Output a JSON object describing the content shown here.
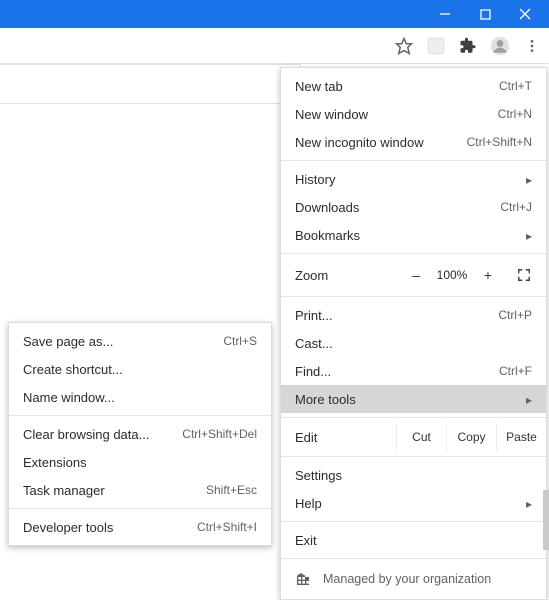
{
  "window_controls": {
    "minimize": "–",
    "maximize": "▢",
    "close": "×"
  },
  "main_menu": {
    "new_tab": {
      "label": "New tab",
      "shortcut": "Ctrl+T"
    },
    "new_window": {
      "label": "New window",
      "shortcut": "Ctrl+N"
    },
    "new_incognito": {
      "label": "New incognito window",
      "shortcut": "Ctrl+Shift+N"
    },
    "history": {
      "label": "History"
    },
    "downloads": {
      "label": "Downloads",
      "shortcut": "Ctrl+J"
    },
    "bookmarks": {
      "label": "Bookmarks"
    },
    "zoom": {
      "label": "Zoom",
      "minus": "–",
      "value": "100%",
      "plus": "+"
    },
    "print": {
      "label": "Print...",
      "shortcut": "Ctrl+P"
    },
    "cast": {
      "label": "Cast..."
    },
    "find": {
      "label": "Find...",
      "shortcut": "Ctrl+F"
    },
    "more_tools": {
      "label": "More tools"
    },
    "edit": {
      "label": "Edit",
      "cut": "Cut",
      "copy": "Copy",
      "paste": "Paste"
    },
    "settings": {
      "label": "Settings"
    },
    "help": {
      "label": "Help"
    },
    "exit": {
      "label": "Exit"
    },
    "managed": {
      "label": "Managed by your organization"
    }
  },
  "sub_menu": {
    "save_page": {
      "label": "Save page as...",
      "shortcut": "Ctrl+S"
    },
    "create_shortcut": {
      "label": "Create shortcut..."
    },
    "name_window": {
      "label": "Name window..."
    },
    "clear_browsing": {
      "label": "Clear browsing data...",
      "shortcut": "Ctrl+Shift+Del"
    },
    "extensions": {
      "label": "Extensions"
    },
    "task_manager": {
      "label": "Task manager",
      "shortcut": "Shift+Esc"
    },
    "developer_tools": {
      "label": "Developer tools",
      "shortcut": "Ctrl+Shift+I"
    }
  }
}
